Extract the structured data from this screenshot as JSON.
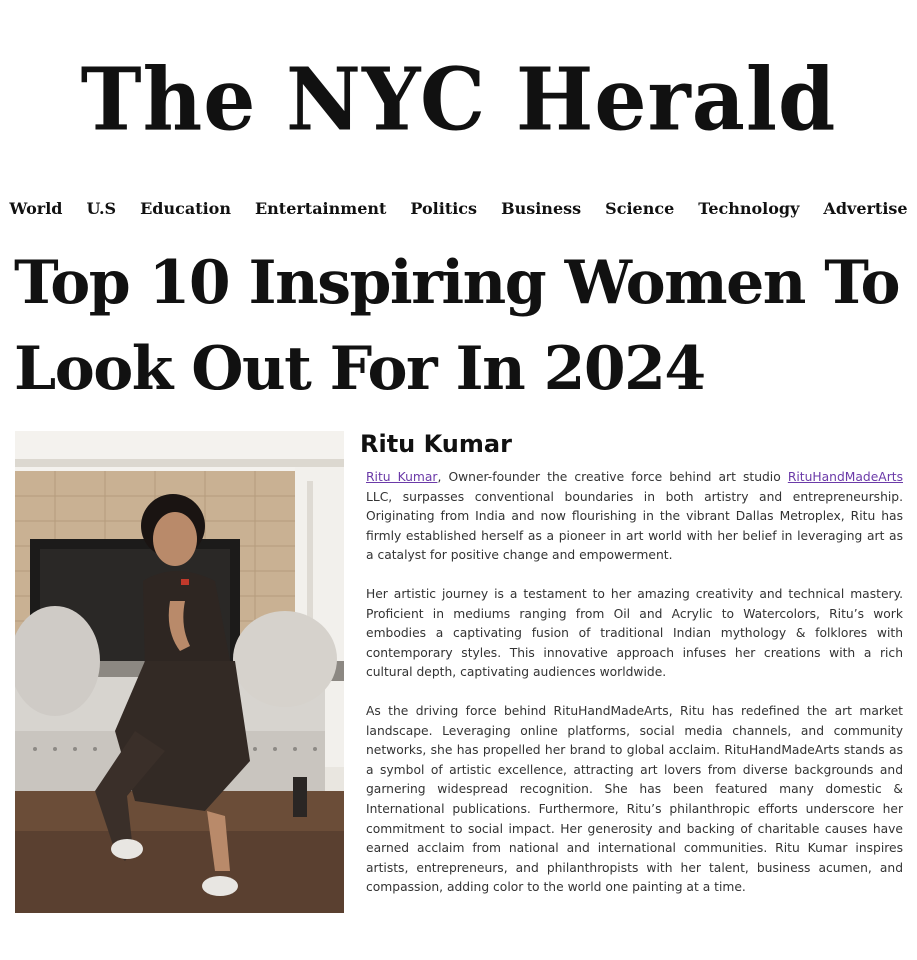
{
  "masthead": {
    "title": "The NYC Herald"
  },
  "nav": {
    "items": [
      "World",
      "U.S",
      "Education",
      "Entertainment",
      "Politics",
      "Business",
      "Science",
      "Technology",
      "Advertise"
    ]
  },
  "headline": {
    "line1": "Top 10 Inspiring Women To",
    "line2": "Look Out For In 2024"
  },
  "article": {
    "name": "Ritu Kumar",
    "p1_link1": "Ritu Kumar",
    "p1_text1": ", Owner-founder the creative force behind art studio ",
    "p1_link2": "RituHandMadeArts",
    "p1_text2": " LLC, surpasses conventional boundaries in both artistry and entrepreneurship. Originating from India and now flourishing in the vibrant Dallas Metroplex, Ritu has firmly established herself as a pioneer in art world with her belief in leveraging art as a catalyst for positive change and empowerment.",
    "p2": "Her artistic journey is a testament to her amazing creativity and technical mastery. Proficient in mediums ranging from Oil and Acrylic to Watercolors, Ritu’s work embodies a captivating fusion of traditional Indian mythology & folklores with contemporary styles. This innovative approach infuses her creations with a rich cultural depth, captivating audiences worldwide.",
    "p3": "As the driving force behind RituHandMadeArts, Ritu has redefined the art market landscape. Leveraging online platforms, social media channels, and community networks, she has propelled her brand to global acclaim. RituHandMadeArts stands as a symbol of artistic excellence, attracting art lovers from diverse backgrounds and garnering widespread recognition. She has been featured many domestic & International publications. Furthermore, Ritu’s philanthropic efforts underscore her commitment to social impact. Her generosity and backing of charitable causes have earned acclaim from national and international communities. Ritu Kumar inspires artists, entrepreneurs, and philanthropists with her talent, business acumen, and compassion, adding color to the world one painting at a time."
  },
  "colors": {
    "link": "#6b3aa8",
    "text": "#333333",
    "heading": "#111111"
  }
}
